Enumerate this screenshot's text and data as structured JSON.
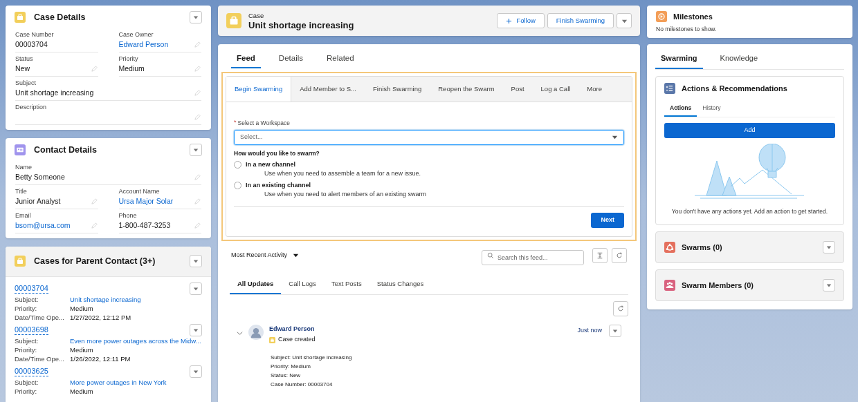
{
  "case_details": {
    "title": "Case Details",
    "rows": [
      [
        {
          "label": "Case Number",
          "value": "00003704",
          "kind": "text",
          "editable": false
        },
        {
          "label": "Case Owner",
          "value": "Edward Person",
          "kind": "link",
          "editable": true
        }
      ],
      [
        {
          "label": "Status",
          "value": "New",
          "kind": "text",
          "editable": true
        },
        {
          "label": "Priority",
          "value": "Medium",
          "kind": "text",
          "editable": true
        }
      ],
      [
        {
          "label": "Subject",
          "value": "Unit shortage increasing",
          "kind": "text",
          "editable": true
        }
      ],
      [
        {
          "label": "Description",
          "kind": "text",
          "editable": true
        }
      ]
    ]
  },
  "contact_details": {
    "title": "Contact Details",
    "rows": [
      [
        {
          "label": "Name",
          "value": "Betty Someone",
          "kind": "text",
          "editable": true
        }
      ],
      [
        {
          "label": "Title",
          "value": "Junior Analyst",
          "kind": "text",
          "editable": true
        },
        {
          "label": "Account Name",
          "value": "Ursa Major Solar",
          "kind": "link",
          "editable": true
        }
      ],
      [
        {
          "label": "Email",
          "value": "bsom@ursa.com",
          "kind": "link",
          "editable": true
        },
        {
          "label": "Phone",
          "value": "1-800-487-3253",
          "kind": "text",
          "editable": true
        }
      ]
    ]
  },
  "related_cases": {
    "title": "Cases for Parent Contact (3+)",
    "records": [
      {
        "number": "00003704",
        "fields": [
          {
            "label": "Subject:",
            "value": "Unit shortage increasing",
            "kind": "link"
          },
          {
            "label": "Priority:",
            "value": "Medium",
            "kind": "text"
          },
          {
            "label": "Date/Time Ope...",
            "value": "1/27/2022, 12:12 PM",
            "kind": "text"
          }
        ]
      },
      {
        "number": "00003698",
        "fields": [
          {
            "label": "Subject:",
            "value": "Even more power outages across the Midw...",
            "kind": "link"
          },
          {
            "label": "Priority:",
            "value": "Medium",
            "kind": "text"
          },
          {
            "label": "Date/Time Ope...",
            "value": "1/26/2022, 12:11 PM",
            "kind": "text"
          }
        ]
      },
      {
        "number": "00003625",
        "fields": [
          {
            "label": "Subject:",
            "value": "More power outages in New York",
            "kind": "link"
          },
          {
            "label": "Priority:",
            "value": "Medium",
            "kind": "text"
          }
        ]
      }
    ]
  },
  "record_header": {
    "object": "Case",
    "title": "Unit shortage increasing",
    "buttons": [
      {
        "label": "Follow",
        "kind": "follow"
      },
      {
        "label": "Finish Swarming",
        "kind": "plain"
      }
    ]
  },
  "main_tabs": [
    {
      "label": "Feed",
      "selected": true
    },
    {
      "label": "Details",
      "selected": false
    },
    {
      "label": "Related",
      "selected": false
    }
  ],
  "publisher": {
    "tabs": [
      {
        "label": "Begin Swarming",
        "selected": true
      },
      {
        "label": "Add Member to S...",
        "selected": false
      },
      {
        "label": "Finish Swarming",
        "selected": false
      },
      {
        "label": "Reopen the Swarm",
        "selected": false
      },
      {
        "label": "Post",
        "selected": false
      },
      {
        "label": "Log a Call",
        "selected": false
      },
      {
        "label": "More",
        "selected": false
      }
    ],
    "field": {
      "label": "Select a Workspace",
      "required_mark": "*",
      "placeholder": "Select..."
    },
    "question": "How would you like to swarm?",
    "options": [
      {
        "label": "In a new channel",
        "description": "Use when you need to assemble a team for a new issue.",
        "selected": false
      },
      {
        "label": "In an existing channel",
        "description": "Use when you need to alert members of an existing swarm",
        "selected": false
      }
    ],
    "submit": "Next"
  },
  "feed": {
    "sort": "Most Recent Activity",
    "search_placeholder": "Search this feed...",
    "filters": [
      {
        "label": "All Updates",
        "selected": true
      },
      {
        "label": "Call Logs",
        "selected": false
      },
      {
        "label": "Text Posts",
        "selected": false
      },
      {
        "label": "Status Changes",
        "selected": false
      }
    ],
    "items": [
      {
        "author": "Edward Person",
        "action": "Case created",
        "time": "Just now",
        "expanded": true,
        "details": [
          "Subject: Unit shortage increasing",
          "Priority: Medium",
          "Status: New",
          "Case Number: 00003704"
        ]
      }
    ]
  },
  "milestones": {
    "title": "Milestones",
    "empty": "No milestones to show."
  },
  "side_tabs": [
    {
      "label": "Swarming",
      "selected": true
    },
    {
      "label": "Knowledge",
      "selected": false
    }
  ],
  "actions_card": {
    "title": "Actions & Recommendations",
    "tabs": [
      {
        "label": "Actions",
        "selected": true
      },
      {
        "label": "History",
        "selected": false
      }
    ],
    "button": "Add",
    "empty": "You don't have any actions yet. Add an action to get started."
  },
  "related_lists": [
    {
      "title": "Swarms (0)",
      "color": "#e4705e",
      "kind": "swarms"
    },
    {
      "title": "Swarm Members (0)",
      "color": "#d9627f",
      "kind": "members"
    }
  ]
}
